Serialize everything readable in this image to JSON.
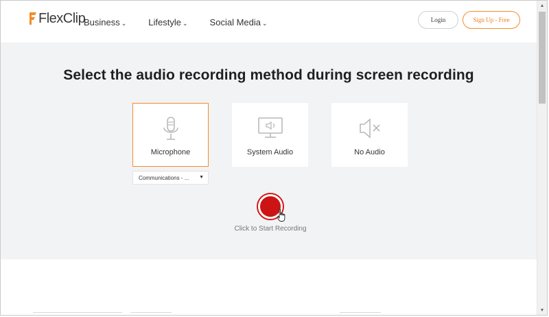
{
  "header": {
    "logo_text": "FlexClip",
    "nav": [
      {
        "label": "Business"
      },
      {
        "label": "Lifestyle"
      },
      {
        "label": "Social Media"
      }
    ],
    "login_label": "Login",
    "signup_label": "Sign Up - Free"
  },
  "main": {
    "title": "Select the audio recording method during screen recording",
    "options": [
      {
        "label": "Microphone",
        "icon": "microphone-icon",
        "selected": true
      },
      {
        "label": "System Audio",
        "icon": "monitor-speaker-icon",
        "selected": false
      },
      {
        "label": "No Audio",
        "icon": "speaker-muted-icon",
        "selected": false
      }
    ],
    "mic_select_value": "Communications - ...",
    "record_label": "Click to Start Recording"
  },
  "colors": {
    "accent": "#f28c28",
    "record": "#cc1414",
    "panel_bg": "#f2f3f5"
  }
}
